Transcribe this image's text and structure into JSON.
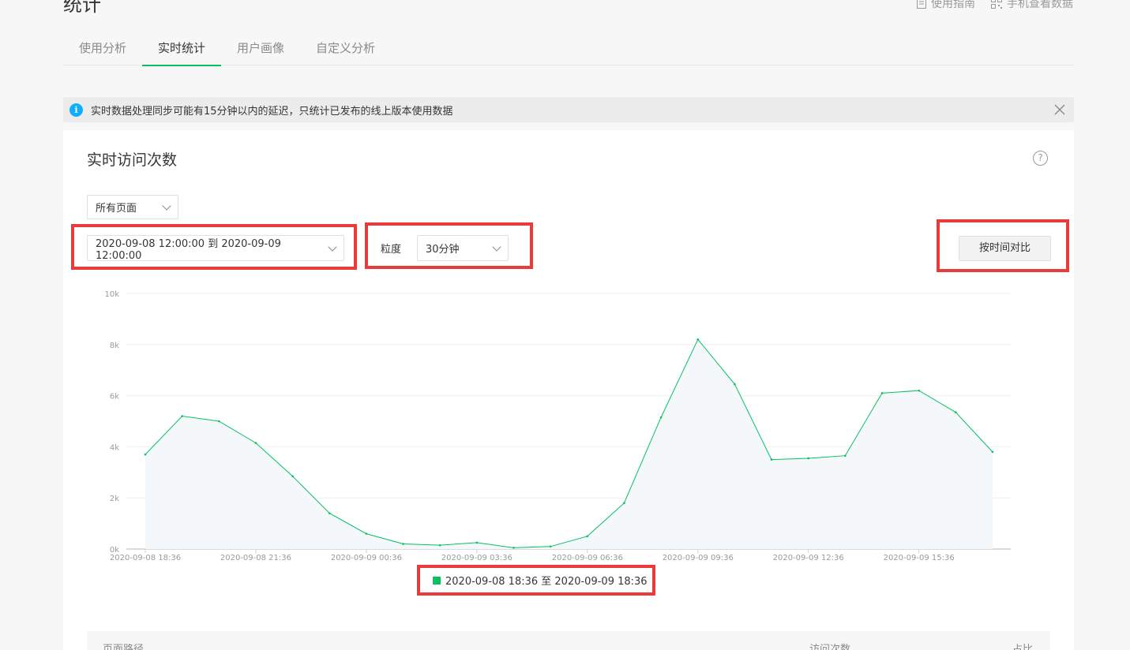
{
  "page": {
    "title": "统计"
  },
  "top_links": [
    {
      "label": "使用指南",
      "icon": "document-icon"
    },
    {
      "label": "手机查看数据",
      "icon": "qrcode-icon"
    }
  ],
  "tabs": [
    {
      "label": "使用分析",
      "active": false
    },
    {
      "label": "实时统计",
      "active": true
    },
    {
      "label": "用户画像",
      "active": false
    },
    {
      "label": "自定义分析",
      "active": false
    }
  ],
  "notice": {
    "text": "实时数据处理同步可能有15分钟以内的延迟，只统计已发布的线上版本使用数据"
  },
  "card": {
    "title": "实时访问次数",
    "page_select": "所有页面",
    "date_range": "2020-09-08 12:00:00 到 2020-09-09 12:00:00",
    "granularity_label": "粒度",
    "granularity_value": "30分钟",
    "compare_button": "按时间对比",
    "legend": "2020-09-08 18:36 至 2020-09-09 18:36"
  },
  "table": {
    "col_path": "页面路径",
    "col_visits": "访问次数",
    "col_ratio": "占比"
  },
  "colors": {
    "accent": "#07c160",
    "info": "#10aeff",
    "highlight": "#ea3b3b"
  },
  "chart_data": {
    "type": "area",
    "x_tick_labels": [
      "2020-09-08 18:36",
      "2020-09-08 21:36",
      "2020-09-09 00:36",
      "2020-09-09 03:36",
      "2020-09-09 06:36",
      "2020-09-09 09:36",
      "2020-09-09 12:36",
      "2020-09-09 15:36"
    ],
    "y_tick_labels": [
      "0k",
      "2k",
      "4k",
      "6k",
      "8k",
      "10k"
    ],
    "ylim": [
      0,
      10000
    ],
    "grid": true,
    "legend_position": "bottom",
    "series": [
      {
        "name": "2020-09-08 18:36 至 2020-09-09 18:36",
        "color": "#07c160",
        "values": [
          3700,
          5200,
          5000,
          4150,
          2850,
          1400,
          600,
          200,
          150,
          250,
          50,
          100,
          500,
          1800,
          5150,
          8200,
          6450,
          3500,
          3550,
          3650,
          6100,
          6200,
          5350,
          3800
        ]
      }
    ]
  }
}
